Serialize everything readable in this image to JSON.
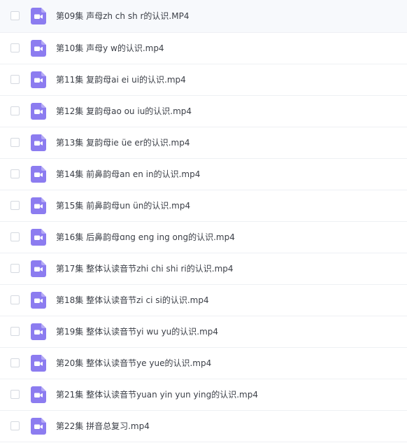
{
  "file_list": {
    "icon": "video-file-icon",
    "icon_color": "#8c7cf0",
    "items": [
      {
        "name": "第09集 声母zh ch sh r的认识.MP4"
      },
      {
        "name": "第10集 声母y w的认识.mp4"
      },
      {
        "name": "第11集 复韵母ai ei ui的认识.mp4"
      },
      {
        "name": "第12集 复韵母ao ou iu的认识.mp4"
      },
      {
        "name": "第13集 复韵母ie üe er的认识.mp4"
      },
      {
        "name": "第14集 前鼻韵母an en in的认识.mp4"
      },
      {
        "name": "第15集 前鼻韵母un ün的认识.mp4"
      },
      {
        "name": "第16集 后鼻韵母ɑng eng ing ong的认识.mp4"
      },
      {
        "name": "第17集 整体认读音节zhi chi shi ri的认识.mp4"
      },
      {
        "name": "第18集 整体认读音节zi ci si的认识.mp4"
      },
      {
        "name": "第19集 整体认读音节yi wu yu的认识.mp4"
      },
      {
        "name": "第20集 整体认读音节ye yue的认识.mp4"
      },
      {
        "name": "第21集 整体认读音节yuan yin yun ying的认识.mp4"
      },
      {
        "name": "第22集 拼音总复习.mp4"
      }
    ]
  }
}
